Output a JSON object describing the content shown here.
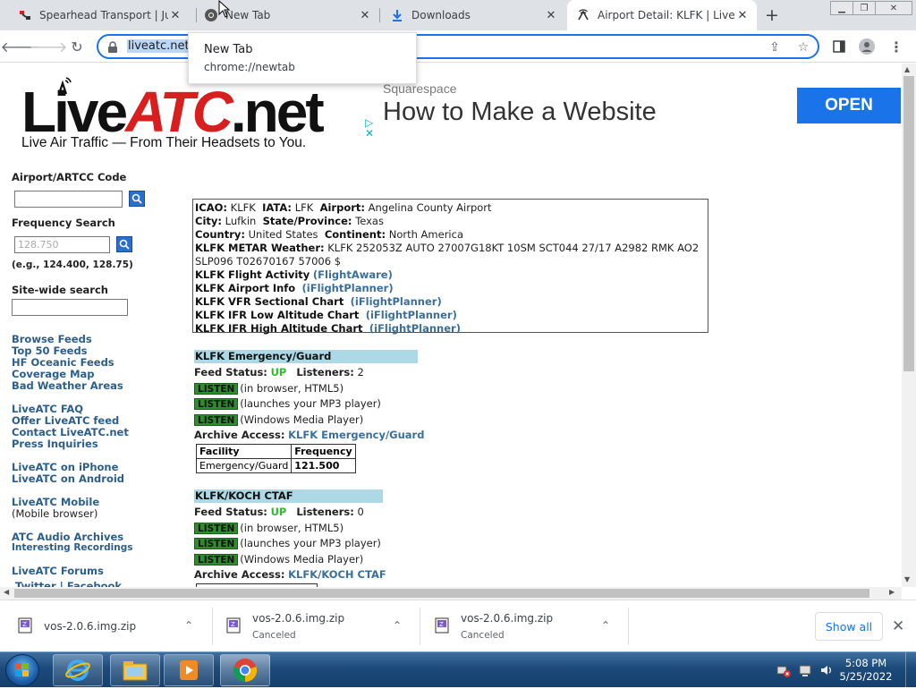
{
  "browser": {
    "tabs": [
      {
        "title": "Spearhead Transport | Just",
        "icon": "spearhead-favicon"
      },
      {
        "title": "New Tab",
        "icon": "chrome-icon"
      },
      {
        "title": "Downloads",
        "icon": "download-icon"
      },
      {
        "title": "Airport Detail: KLFK | LiveA",
        "icon": "liveatc-favicon"
      }
    ],
    "url": "liveatc.net/",
    "tooltip": {
      "title": "New Tab",
      "url": "chrome://newtab"
    }
  },
  "site": {
    "logo": {
      "live": "Live",
      "atc": "ATC",
      "net": ".net",
      "tagline": "Live Air Traffic — From Their Headsets to You."
    },
    "ad": {
      "small": "Squarespace",
      "headline": "How to Make a Website",
      "button": "OPEN"
    },
    "nav": {
      "airport_label": "Airport/ARTCC Code",
      "freq_label": "Frequency Search",
      "freq_placeholder": "128.750",
      "freq_hint": "(e.g., 124.400, 128.75)",
      "sitewide_label": "Site-wide search",
      "links1": [
        "Browse Feeds",
        "Top 50 Feeds",
        "HF Oceanic Feeds",
        "Coverage Map",
        "Bad Weather Areas"
      ],
      "links2": [
        "LiveATC FAQ",
        "Offer LiveATC feed",
        "Contact LiveATC.net",
        "Press Inquiries"
      ],
      "links3": [
        "LiveATC on iPhone",
        "LiveATC on Android"
      ],
      "mobile": "LiveATC Mobile",
      "mobile_sub": "(Mobile browser)",
      "archives": "ATC Audio Archives",
      "interesting": "Interesting Recordings",
      "forums": "LiveATC Forums",
      "twitter": "Twitter | Facebook"
    },
    "airport": {
      "icao_label": "ICAO:",
      "icao": "KLFK",
      "iata_label": "IATA:",
      "iata": "LFK",
      "airport_label": "Airport:",
      "airport": "Angelina County Airport",
      "city_label": "City:",
      "city": "Lufkin",
      "state_label": "State/Province:",
      "state": "Texas",
      "country_label": "Country:",
      "country": "United States",
      "continent_label": "Continent:",
      "continent": "North America",
      "metar_label": "KLFK METAR Weather:",
      "metar": "KLFK 252053Z AUTO 27007G18KT 10SM SCT044 27/17 A2982 RMK AO2",
      "metar2": "SLP096 T02670167 57006 $",
      "resources": [
        {
          "label": "KLFK Flight Activity",
          "link": "(FlightAware)"
        },
        {
          "label": "KLFK Airport Info",
          "link": "(iFlightPlanner)"
        },
        {
          "label": "KLFK VFR Sectional Chart",
          "link": "(iFlightPlanner)"
        },
        {
          "label": "KLFK IFR Low Altitude Chart",
          "link": "(iFlightPlanner)"
        },
        {
          "label": "KLFK IFR High Altitude Chart",
          "link": "(iFlightPlanner)"
        }
      ]
    },
    "feeds": [
      {
        "name": "KLFK Emergency/Guard",
        "status_label": "Feed Status:",
        "status": "UP",
        "listeners_label": "Listeners:",
        "listeners": "2",
        "listen": "LISTEN",
        "opt1": "(in browser, HTML5)",
        "opt2": "(launches your MP3 player)",
        "opt3": "(Windows Media Player)",
        "archive_label": "Archive Access:",
        "archive_link": "KLFK Emergency/Guard",
        "th_facility": "Facility",
        "th_frequency": "Frequency",
        "facility": "Emergency/Guard",
        "frequency": "121.500"
      },
      {
        "name": "KLFK/KOCH CTAF",
        "status_label": "Feed Status:",
        "status": "UP",
        "listeners_label": "Listeners:",
        "listeners": "0",
        "listen": "LISTEN",
        "opt1": "(in browser, HTML5)",
        "opt2": "(launches your MP3 player)",
        "opt3": "(Windows Media Player)",
        "archive_label": "Archive Access:",
        "archive_link": "KLFK/KOCH CTAF"
      }
    ]
  },
  "downloads": {
    "items": [
      {
        "name": "vos-2.0.6.img.zip",
        "status": ""
      },
      {
        "name": "vos-2.0.6.img.zip",
        "status": "Canceled"
      },
      {
        "name": "vos-2.0.6.img.zip",
        "status": "Canceled"
      }
    ],
    "show_all": "Show all"
  },
  "taskbar": {
    "time": "5:08 PM",
    "date": "5/25/2022",
    "apps": [
      "internet-explorer-icon",
      "file-explorer-icon",
      "media-player-icon",
      "chrome-icon"
    ]
  },
  "colors": {
    "accent": "#1a73e8",
    "tab_strip": "#dee1e6",
    "live_red": "#d81e1e",
    "feed_header": "#add8e6",
    "listen_green": "#2e8b2e"
  }
}
